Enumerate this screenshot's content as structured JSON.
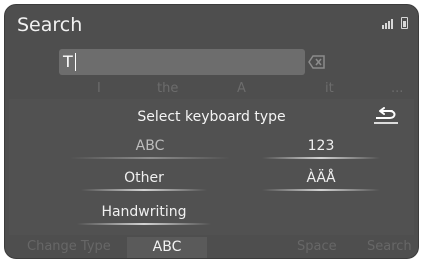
{
  "header": {
    "title": "Search"
  },
  "search": {
    "value": "T"
  },
  "predictions": [
    "I",
    "the",
    "A",
    "it"
  ],
  "predictions_more": "...",
  "dialog": {
    "title": "Select keyboard type",
    "options": {
      "abc": "ABC",
      "num": "123",
      "other": "Other",
      "accent": "ÀÄÅ",
      "handwriting": "Handwriting"
    }
  },
  "bottom": {
    "change_type": "Change Type",
    "current_type": "ABC",
    "space": "Space",
    "search": "Search"
  }
}
